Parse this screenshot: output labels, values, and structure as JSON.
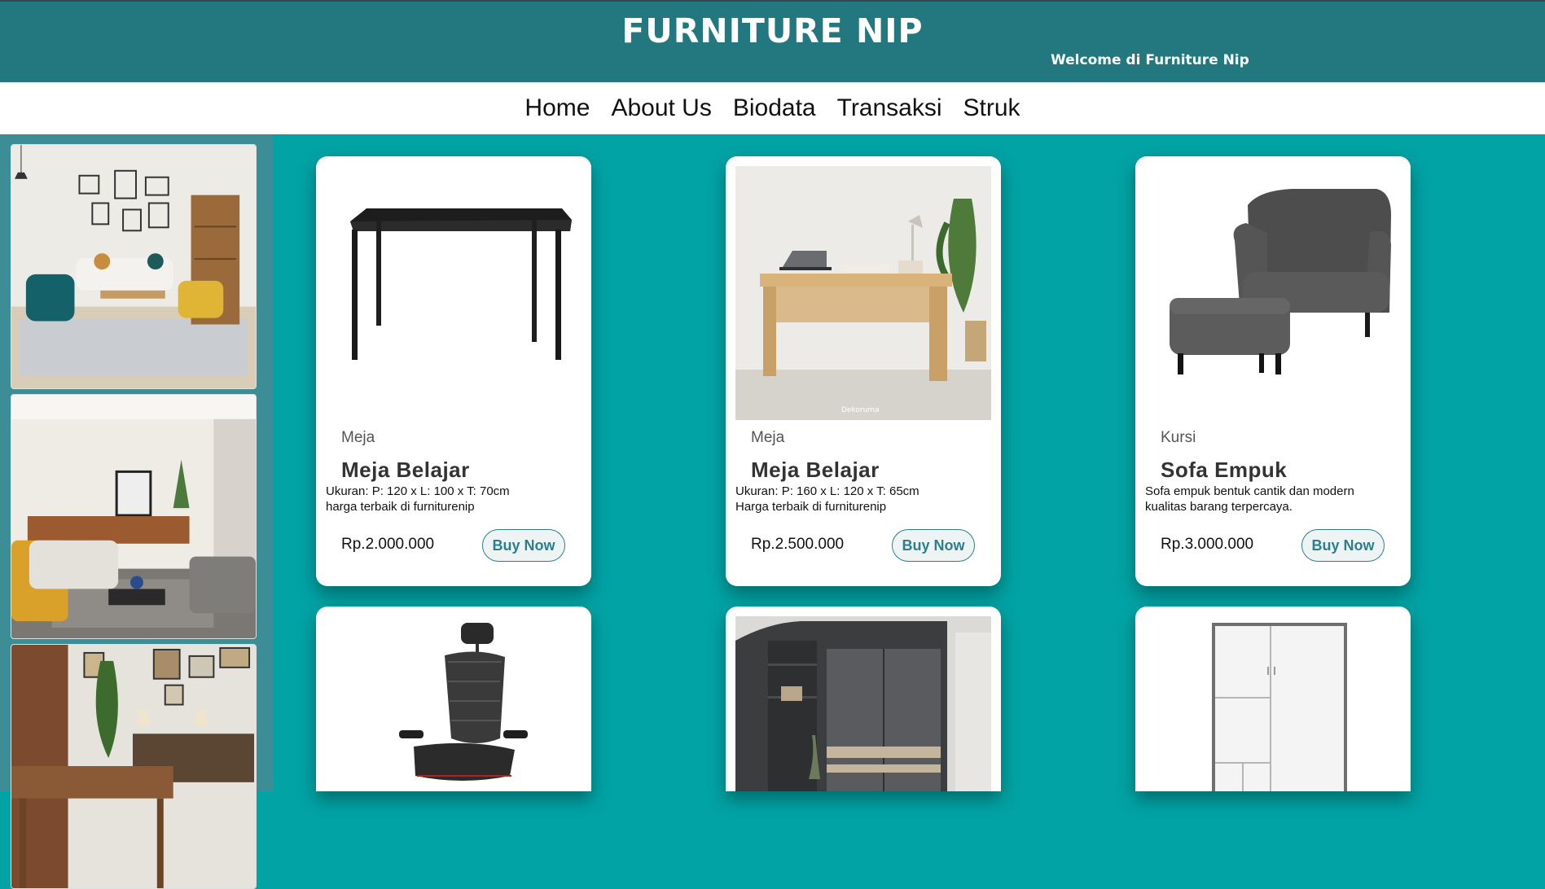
{
  "header": {
    "title": "FURNITURE NIP",
    "tagline": "Welcome di Furniture Nip"
  },
  "nav": {
    "items": [
      "Home",
      "About Us",
      "Biodata",
      "Transaksi",
      "Struk"
    ]
  },
  "products": [
    {
      "category": "Meja",
      "name": "Meja Belajar",
      "desc_line1": "Ukuran: P: 120 x L: 100 x T: 70cm",
      "desc_line2": "harga terbaik di furniturenip",
      "price": "Rp.2.000.000",
      "button": "Buy Now"
    },
    {
      "category": "Meja",
      "name": "Meja Belajar",
      "desc_line1": "Ukuran: P: 160 x L: 120 x T: 65cm",
      "desc_line2": "Harga terbaik di furniturenip",
      "price": "Rp.2.500.000",
      "button": "Buy Now"
    },
    {
      "category": "Kursi",
      "name": "Sofa Empuk",
      "desc_line1": "Sofa empuk bentuk cantik dan modern",
      "desc_line2": "kualitas barang terpercaya.",
      "price": "Rp.3.000.000",
      "button": "Buy Now"
    }
  ],
  "colors": {
    "header_bg": "#237880",
    "page_bg": "#02a3a5",
    "sidebar_bg": "#3d8d97",
    "button_text": "#2c7f8c"
  },
  "icons": {
    "image_watermark": "Dekoruma"
  }
}
